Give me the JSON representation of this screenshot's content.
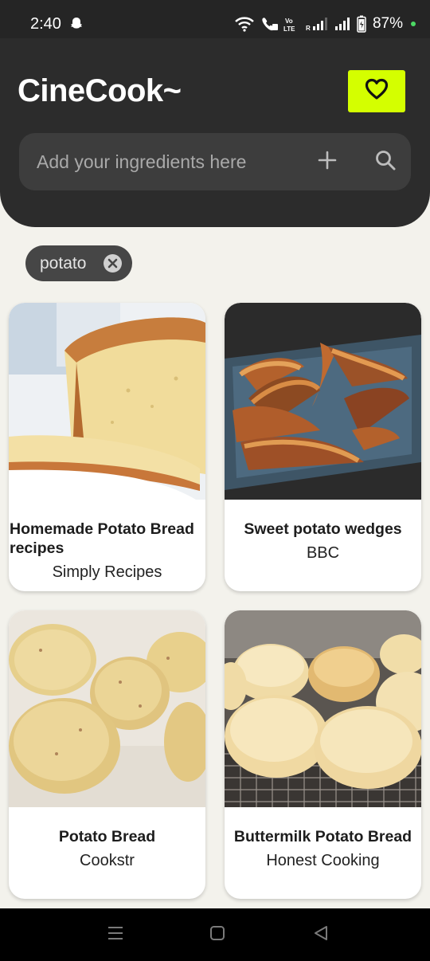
{
  "status_bar": {
    "time": "2:40",
    "battery": "87%",
    "icons": [
      "snapchat-icon",
      "wifi-icon",
      "call-icon",
      "volte-icon",
      "signal-icon",
      "signal-icon",
      "battery-icon"
    ]
  },
  "header": {
    "app_title": "CineCook~",
    "favorites_icon": "heart-icon",
    "accent_color": "#d4ff00"
  },
  "search": {
    "placeholder": "Add your ingredients here",
    "value": "",
    "add_icon": "plus-icon",
    "search_icon": "search-icon"
  },
  "chips": [
    {
      "label": "potato",
      "remove_icon": "close-circle-icon"
    }
  ],
  "recipes": [
    {
      "title": "Homemade Potato Bread recipes",
      "source": "Simply Recipes",
      "image": "potato-bread-loaf"
    },
    {
      "title": "Sweet potato wedges",
      "source": "BBC",
      "image": "sweet-potato-wedges"
    },
    {
      "title": "Potato Bread",
      "source": "Cookstr",
      "image": "raw-potatoes"
    },
    {
      "title": "Buttermilk Potato Bread",
      "source": "Honest Cooking",
      "image": "buttermilk-rolls"
    }
  ],
  "nav_bar": {
    "buttons": [
      "recents-icon",
      "home-icon",
      "back-icon"
    ]
  }
}
